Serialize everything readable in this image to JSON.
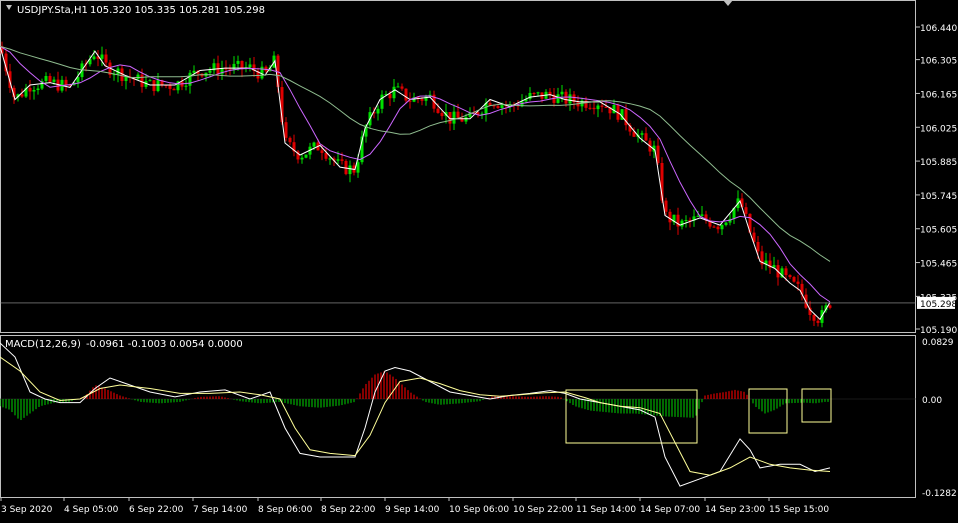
{
  "window": {
    "symbol_header": "USDJPY.Sta,H1",
    "ohlc": "105.320 105.335 105.281 105.298"
  },
  "macd": {
    "header": "MACD(12,26,9)",
    "values": "-0.0961 -0.1003 0.0054 0.0000"
  },
  "price_axis": {
    "ticks": [
      "106.440",
      "106.305",
      "106.165",
      "106.025",
      "105.885",
      "105.745",
      "105.605",
      "105.465",
      "105.325",
      "105.190"
    ],
    "current_price": "105.298"
  },
  "macd_axis": {
    "ticks": [
      "0.0829",
      "0.00",
      "-0.1282"
    ]
  },
  "time_axis": {
    "labels": [
      "3 Sep 2020",
      "4 Sep 05:00",
      "6 Sep 22:00",
      "7 Sep 14:00",
      "8 Sep 06:00",
      "8 Sep 22:00",
      "9 Sep 14:00",
      "10 Sep 06:00",
      "10 Sep 22:00",
      "11 Sep 14:00",
      "14 Sep 07:00",
      "14 Sep 23:00",
      "15 Sep 15:00"
    ]
  },
  "colors": {
    "background": "#000000",
    "bull_candle": "#00e000",
    "bear_candle": "#e00000",
    "ma_fast": "#ffffff",
    "ma_slow": "#cc66ff",
    "ma_long": "#8fbc8f",
    "macd_line": "#ffffff",
    "signal_line": "#ffff99",
    "hist_pos": "#e00000",
    "hist_neg": "#00b000",
    "box": "#ffff99",
    "axis": "#c0c0c0"
  },
  "chart_data": [
    {
      "type": "candlestick",
      "title": "USDJPY.Sta,H1",
      "ylim": [
        105.17,
        106.5
      ],
      "close_points": [
        [
          0,
          106.36
        ],
        [
          15,
          106.14
        ],
        [
          30,
          106.2
        ],
        [
          50,
          106.21
        ],
        [
          70,
          106.19
        ],
        [
          95,
          106.34
        ],
        [
          105,
          106.28
        ],
        [
          125,
          106.24
        ],
        [
          150,
          106.2
        ],
        [
          175,
          106.2
        ],
        [
          200,
          106.26
        ],
        [
          225,
          106.27
        ],
        [
          250,
          106.27
        ],
        [
          265,
          106.24
        ],
        [
          275,
          106.3
        ],
        [
          285,
          105.96
        ],
        [
          300,
          105.91
        ],
        [
          320,
          105.95
        ],
        [
          340,
          105.86
        ],
        [
          355,
          105.85
        ],
        [
          365,
          106.02
        ],
        [
          380,
          106.14
        ],
        [
          395,
          106.18
        ],
        [
          410,
          106.14
        ],
        [
          430,
          106.15
        ],
        [
          450,
          106.06
        ],
        [
          470,
          106.06
        ],
        [
          490,
          106.14
        ],
        [
          510,
          106.11
        ],
        [
          530,
          106.15
        ],
        [
          550,
          106.16
        ],
        [
          565,
          106.14
        ],
        [
          580,
          106.13
        ],
        [
          600,
          106.13
        ],
        [
          620,
          106.08
        ],
        [
          640,
          105.98
        ],
        [
          655,
          105.93
        ],
        [
          665,
          105.66
        ],
        [
          680,
          105.62
        ],
        [
          700,
          105.65
        ],
        [
          720,
          105.62
        ],
        [
          740,
          105.72
        ],
        [
          750,
          105.59
        ],
        [
          760,
          105.47
        ],
        [
          775,
          105.44
        ],
        [
          790,
          105.38
        ],
        [
          800,
          105.35
        ],
        [
          810,
          105.27
        ],
        [
          820,
          105.23
        ],
        [
          830,
          105.3
        ]
      ]
    },
    {
      "type": "line+bar",
      "title": "MACD(12,26,9)",
      "ylim": [
        -0.1282,
        0.0829
      ],
      "macd_points": [
        [
          0,
          0.08
        ],
        [
          15,
          0.06
        ],
        [
          30,
          0.01
        ],
        [
          45,
          0.0
        ],
        [
          60,
          -0.005
        ],
        [
          80,
          -0.005
        ],
        [
          95,
          0.015
        ],
        [
          110,
          0.03
        ],
        [
          130,
          0.02
        ],
        [
          150,
          0.01
        ],
        [
          175,
          0.003
        ],
        [
          200,
          0.01
        ],
        [
          225,
          0.013
        ],
        [
          250,
          0.0
        ],
        [
          270,
          0.01
        ],
        [
          285,
          -0.04
        ],
        [
          300,
          -0.075
        ],
        [
          320,
          -0.08
        ],
        [
          340,
          -0.08
        ],
        [
          355,
          -0.08
        ],
        [
          365,
          -0.04
        ],
        [
          375,
          0.01
        ],
        [
          385,
          0.04
        ],
        [
          395,
          0.045
        ],
        [
          410,
          0.04
        ],
        [
          430,
          0.025
        ],
        [
          450,
          0.01
        ],
        [
          470,
          0.005
        ],
        [
          490,
          0.0
        ],
        [
          510,
          0.005
        ],
        [
          530,
          0.008
        ],
        [
          550,
          0.012
        ],
        [
          565,
          0.008
        ],
        [
          580,
          0.0
        ],
        [
          600,
          -0.005
        ],
        [
          620,
          -0.01
        ],
        [
          640,
          -0.015
        ],
        [
          655,
          -0.025
        ],
        [
          665,
          -0.08
        ],
        [
          680,
          -0.12
        ],
        [
          700,
          -0.11
        ],
        [
          720,
          -0.1
        ],
        [
          740,
          -0.055
        ],
        [
          750,
          -0.07
        ],
        [
          760,
          -0.095
        ],
        [
          780,
          -0.09
        ],
        [
          800,
          -0.09
        ],
        [
          815,
          -0.1
        ],
        [
          830,
          -0.095
        ]
      ],
      "signal_points": [
        [
          0,
          0.06
        ],
        [
          20,
          0.04
        ],
        [
          40,
          0.01
        ],
        [
          60,
          -0.002
        ],
        [
          80,
          0.0
        ],
        [
          100,
          0.015
        ],
        [
          120,
          0.02
        ],
        [
          150,
          0.015
        ],
        [
          180,
          0.008
        ],
        [
          210,
          0.008
        ],
        [
          240,
          0.01
        ],
        [
          260,
          0.006
        ],
        [
          280,
          0.0
        ],
        [
          295,
          -0.04
        ],
        [
          310,
          -0.07
        ],
        [
          330,
          -0.075
        ],
        [
          355,
          -0.078
        ],
        [
          370,
          -0.05
        ],
        [
          385,
          -0.005
        ],
        [
          400,
          0.025
        ],
        [
          420,
          0.03
        ],
        [
          440,
          0.022
        ],
        [
          460,
          0.012
        ],
        [
          480,
          0.006
        ],
        [
          500,
          0.004
        ],
        [
          520,
          0.006
        ],
        [
          545,
          0.009
        ],
        [
          565,
          0.01
        ],
        [
          585,
          0.002
        ],
        [
          600,
          -0.005
        ],
        [
          620,
          -0.01
        ],
        [
          640,
          -0.012
        ],
        [
          660,
          -0.02
        ],
        [
          675,
          -0.06
        ],
        [
          690,
          -0.1
        ],
        [
          710,
          -0.105
        ],
        [
          730,
          -0.095
        ],
        [
          750,
          -0.08
        ],
        [
          770,
          -0.09
        ],
        [
          790,
          -0.095
        ],
        [
          810,
          -0.098
        ],
        [
          830,
          -0.1
        ]
      ],
      "histogram": [
        [
          0,
          -0.01
        ],
        [
          10,
          -0.015
        ],
        [
          20,
          -0.03
        ],
        [
          30,
          -0.02
        ],
        [
          40,
          -0.01
        ],
        [
          55,
          -0.005
        ],
        [
          70,
          -0.004
        ],
        [
          85,
          0.004
        ],
        [
          95,
          0.02
        ],
        [
          105,
          0.015
        ],
        [
          120,
          0.005
        ],
        [
          140,
          -0.004
        ],
        [
          160,
          -0.006
        ],
        [
          180,
          -0.004
        ],
        [
          200,
          0.003
        ],
        [
          220,
          0.004
        ],
        [
          240,
          -0.003
        ],
        [
          260,
          -0.006
        ],
        [
          280,
          -0.004
        ],
        [
          300,
          -0.01
        ],
        [
          320,
          -0.012
        ],
        [
          340,
          -0.009
        ],
        [
          355,
          -0.004
        ],
        [
          365,
          0.02
        ],
        [
          375,
          0.035
        ],
        [
          385,
          0.04
        ],
        [
          395,
          0.03
        ],
        [
          410,
          0.01
        ],
        [
          425,
          -0.004
        ],
        [
          440,
          -0.008
        ],
        [
          460,
          -0.006
        ],
        [
          480,
          -0.003
        ],
        [
          495,
          0.005
        ],
        [
          510,
          0.004
        ],
        [
          530,
          0.003
        ],
        [
          545,
          0.004
        ],
        [
          560,
          0.003
        ],
        [
          575,
          -0.01
        ],
        [
          590,
          -0.016
        ],
        [
          605,
          -0.018
        ],
        [
          620,
          -0.02
        ],
        [
          635,
          -0.02
        ],
        [
          650,
          -0.022
        ],
        [
          665,
          -0.024
        ],
        [
          680,
          -0.025
        ],
        [
          695,
          -0.026
        ],
        [
          705,
          0.005
        ],
        [
          715,
          0.008
        ],
        [
          725,
          0.01
        ],
        [
          735,
          0.013
        ],
        [
          745,
          0.01
        ],
        [
          755,
          -0.01
        ],
        [
          765,
          -0.02
        ],
        [
          775,
          -0.015
        ],
        [
          785,
          -0.006
        ],
        [
          805,
          -0.005
        ],
        [
          815,
          -0.006
        ],
        [
          825,
          -0.004
        ]
      ]
    }
  ]
}
